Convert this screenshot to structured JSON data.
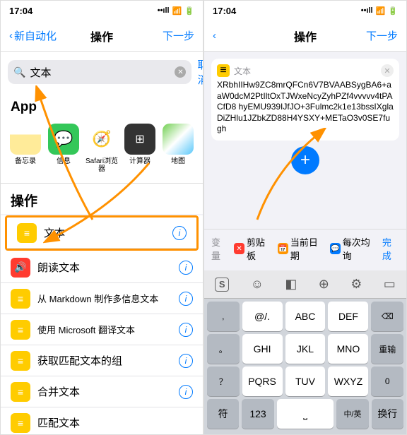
{
  "status": {
    "time": "17:04",
    "signal": "••ıll",
    "wifi": "⟡",
    "battery": "▮▯"
  },
  "left": {
    "nav": {
      "back": "新自动化",
      "title": "操作",
      "next": "下一步"
    },
    "search": {
      "value": "文本",
      "cancel": "取消"
    },
    "section_app": "App",
    "apps": [
      {
        "name": "备忘录"
      },
      {
        "name": "信息"
      },
      {
        "name": "Safari浏览器"
      },
      {
        "name": "计算器"
      },
      {
        "name": "地图"
      }
    ],
    "section_actions": "操作",
    "rows": [
      {
        "label": "文本",
        "color": "#ffcc00"
      },
      {
        "label": "朗读文本",
        "color": "#ff3b30"
      },
      {
        "label": "从 Markdown 制作多信息文本",
        "color": "#ffcc00"
      },
      {
        "label": "使用 Microsoft 翻译文本",
        "color": "#ffcc00"
      },
      {
        "label": "获取匹配文本的组",
        "color": "#ffcc00"
      },
      {
        "label": "合并文本",
        "color": "#ffcc00"
      },
      {
        "label": "匹配文本",
        "color": "#ffcc00"
      }
    ]
  },
  "right": {
    "nav": {
      "title": "操作",
      "next": "下一步"
    },
    "card": {
      "title": "文本",
      "content": "XRbhIIHw9ZC8mrQFCn6V7BVAABSygBA6+aaW0dcM2PtIltOxTJWxeNcyZyhPZf4vvvvv4tPACfD8\nhyEMU939IJfJO+3Fulmc2k1e13bssIXglaDiZHlu1JZbkZD88H4YSXY+METaO3v0SE7fugh"
    },
    "suggest": {
      "label_var": "变量",
      "clip": "剪贴板",
      "date": "当前日期",
      "each": "每次均询",
      "done": "完成"
    },
    "kb": {
      "r1": [
        "@/.",
        "ABC",
        "DEF"
      ],
      "r2": [
        "GHI",
        "JKL",
        "MNO"
      ],
      "r3": [
        "PQRS",
        "TUV",
        "WXYZ"
      ],
      "r4": [
        "符",
        "123",
        "",
        "中/英",
        "换行"
      ],
      "side": [
        "⌫",
        "重输",
        "0"
      ],
      "separator": ","
    }
  }
}
